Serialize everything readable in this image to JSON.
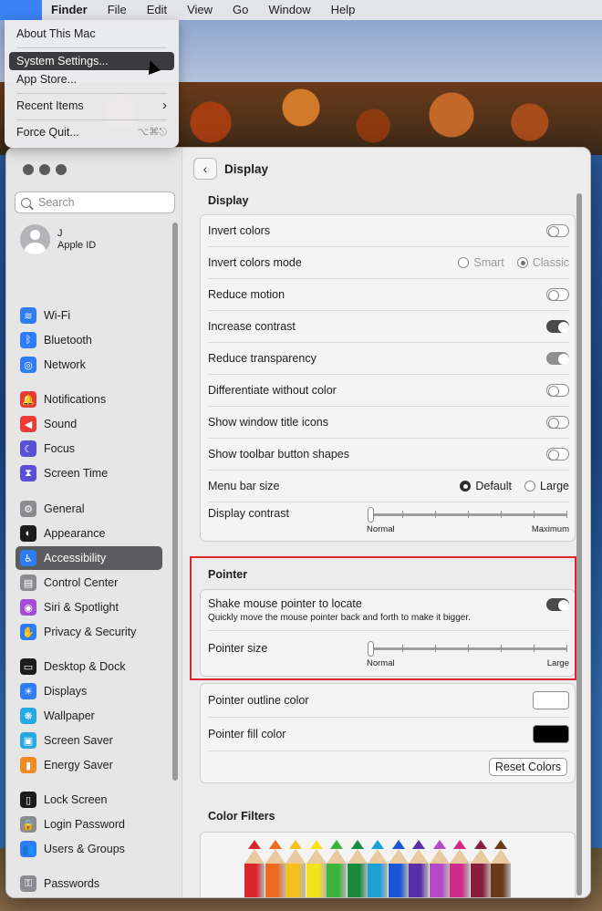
{
  "menubar": {
    "apple_icon": "apple-icon",
    "items": [
      "Finder",
      "File",
      "Edit",
      "View",
      "Go",
      "Window",
      "Help"
    ]
  },
  "apple_menu": {
    "items": [
      {
        "label": "About This Mac"
      },
      {
        "label": "System Settings...",
        "selected": true
      },
      {
        "label": "App Store..."
      },
      {
        "label": "Recent Items",
        "arrow": "›"
      },
      {
        "label": "Force Quit...",
        "shortcut": "⌥⌘⎋"
      }
    ]
  },
  "sidebar": {
    "search_placeholder": "Search",
    "account": {
      "name": "J",
      "subtitle": "Apple ID"
    },
    "groups": [
      [
        {
          "label": "Wi-Fi",
          "icon": "wifi-icon",
          "color": "#2e7cf6",
          "glyph": "≋"
        },
        {
          "label": "Bluetooth",
          "icon": "bluetooth-icon",
          "color": "#2e7cf6",
          "glyph": "ᛒ"
        },
        {
          "label": "Network",
          "icon": "network-icon",
          "color": "#2e7cf6",
          "glyph": "◎"
        }
      ],
      [
        {
          "label": "Notifications",
          "icon": "bell-icon",
          "color": "#ea3c36",
          "glyph": "🔔"
        },
        {
          "label": "Sound",
          "icon": "speaker-icon",
          "color": "#ea3c36",
          "glyph": "◀"
        },
        {
          "label": "Focus",
          "icon": "moon-icon",
          "color": "#5b4fd6",
          "glyph": "☾"
        },
        {
          "label": "Screen Time",
          "icon": "hourglass-icon",
          "color": "#5b4fd6",
          "glyph": "⧗"
        }
      ],
      [
        {
          "label": "General",
          "icon": "gear-icon",
          "color": "#8c8c90",
          "glyph": "⚙"
        },
        {
          "label": "Appearance",
          "icon": "appearance-icon",
          "color": "#1c1c1e",
          "glyph": "◐"
        },
        {
          "label": "Accessibility",
          "icon": "accessibility-icon",
          "color": "#2e7cf6",
          "glyph": "♿",
          "active": true
        },
        {
          "label": "Control Center",
          "icon": "control-center-icon",
          "color": "#8c8c90",
          "glyph": "▤"
        },
        {
          "label": "Siri & Spotlight",
          "icon": "siri-icon",
          "color": "#a54bd9",
          "glyph": "◉"
        },
        {
          "label": "Privacy & Security",
          "icon": "hand-icon",
          "color": "#2e7cf6",
          "glyph": "✋"
        }
      ],
      [
        {
          "label": "Desktop & Dock",
          "icon": "dock-icon",
          "color": "#1c1c1e",
          "glyph": "▭"
        },
        {
          "label": "Displays",
          "icon": "display-icon",
          "color": "#2e7cf6",
          "glyph": "☀"
        },
        {
          "label": "Wallpaper",
          "icon": "wallpaper-icon",
          "color": "#26a9e0",
          "glyph": "❋"
        },
        {
          "label": "Screen Saver",
          "icon": "screensaver-icon",
          "color": "#26a9e0",
          "glyph": "▣"
        },
        {
          "label": "Energy Saver",
          "icon": "battery-icon",
          "color": "#f08a24",
          "glyph": "▮"
        }
      ],
      [
        {
          "label": "Lock Screen",
          "icon": "lock-screen-icon",
          "color": "#1c1c1e",
          "glyph": "▯"
        },
        {
          "label": "Login Password",
          "icon": "lock-icon",
          "color": "#8c8c90",
          "glyph": "🔒"
        },
        {
          "label": "Users & Groups",
          "icon": "users-icon",
          "color": "#2e7cf6",
          "glyph": "👥"
        }
      ],
      [
        {
          "label": "Passwords",
          "icon": "key-icon",
          "color": "#8c8c90",
          "glyph": "⚿"
        }
      ]
    ]
  },
  "main": {
    "title": "Display",
    "display_section": {
      "title": "Display",
      "invert_colors": {
        "label": "Invert colors",
        "on": false
      },
      "invert_mode": {
        "label": "Invert colors mode",
        "options": [
          "Smart",
          "Classic"
        ],
        "selected": "Classic"
      },
      "reduce_motion": {
        "label": "Reduce motion",
        "on": false
      },
      "increase_contrast": {
        "label": "Increase contrast",
        "on": true
      },
      "reduce_transparency": {
        "label": "Reduce transparency",
        "on": true
      },
      "differentiate": {
        "label": "Differentiate without color",
        "on": false
      },
      "title_icons": {
        "label": "Show window title icons",
        "on": false
      },
      "toolbar_shapes": {
        "label": "Show toolbar button shapes",
        "on": false
      },
      "menu_bar_size": {
        "label": "Menu bar size",
        "options": [
          "Default",
          "Large"
        ],
        "selected": "Default"
      },
      "display_contrast": {
        "label": "Display contrast",
        "min_label": "Normal",
        "max_label": "Maximum",
        "value": 0
      }
    },
    "pointer_section": {
      "title": "Pointer",
      "shake": {
        "label": "Shake mouse pointer to locate",
        "description": "Quickly move the mouse pointer back and forth to make it bigger.",
        "on": true
      },
      "pointer_size": {
        "label": "Pointer size",
        "min_label": "Normal",
        "max_label": "Large",
        "value": 0
      }
    },
    "colors_section": {
      "outline": {
        "label": "Pointer outline color",
        "color": "#ffffff"
      },
      "fill": {
        "label": "Pointer fill color",
        "color": "#000000"
      },
      "reset_label": "Reset Colors"
    },
    "color_filters": {
      "title": "Color Filters",
      "pencil_colors": [
        "#d8262a",
        "#ee6a1f",
        "#f5c21b",
        "#f4e21a",
        "#3cb339",
        "#178a3e",
        "#1c9fd4",
        "#1c56d8",
        "#5a2ea8",
        "#b44ac8",
        "#d12a8a",
        "#8a1c3c",
        "#6b3a1a"
      ]
    }
  },
  "colors": {
    "accent": "#2e7cf6",
    "highlight_box": "#e0262b"
  }
}
